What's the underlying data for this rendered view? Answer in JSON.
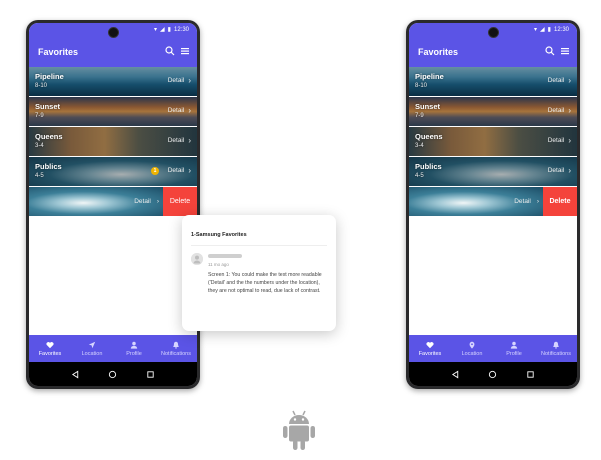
{
  "status_bar": {
    "time": "12:30"
  },
  "app": {
    "title": "Favorites"
  },
  "list_items": [
    {
      "name": "Pipeline",
      "nums": "8-10",
      "detail": "Detail"
    },
    {
      "name": "Sunset",
      "nums": "7-9",
      "detail": "Detail"
    },
    {
      "name": "Queens",
      "nums": "3-4",
      "detail": "Detail"
    },
    {
      "name": "Publics",
      "nums": "4-5",
      "detail": "Detail"
    }
  ],
  "swiped_row": {
    "detail": "Detail",
    "delete": "Delete"
  },
  "bottom_nav": [
    {
      "label": "Favorites",
      "icon": "heart-icon"
    },
    {
      "label": "Location",
      "icon": "location-icon"
    },
    {
      "label": "Profile",
      "icon": "profile-icon"
    },
    {
      "label": "Notifications",
      "icon": "bell-icon"
    }
  ],
  "badge": {
    "count": "1"
  },
  "comment": {
    "title": "1-Samsung Favorites",
    "time": "11 mo ago",
    "body": "Screen 1: You could make the text more readable ('Detail' and the the numbers under the location), they are not optimal to read, due lack of contrast."
  },
  "colors": {
    "accent": "#5b54e6",
    "delete": "#f4433b",
    "badge": "#f0b400"
  }
}
